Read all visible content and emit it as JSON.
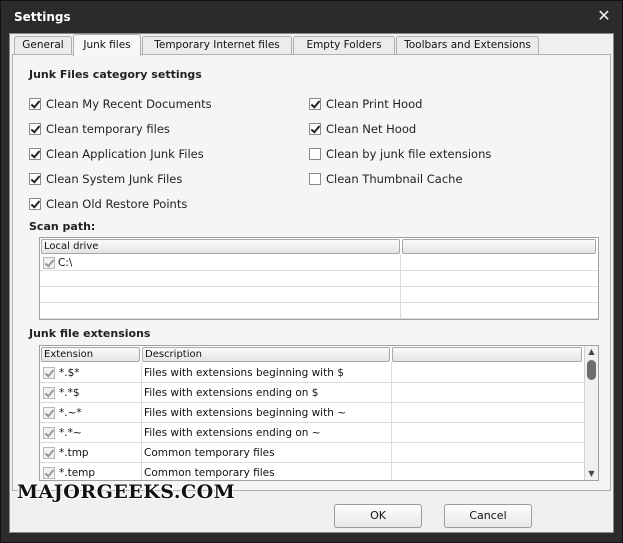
{
  "window": {
    "title": "Settings",
    "close_glyph": "✕"
  },
  "tabs": [
    {
      "label": "General",
      "active": false
    },
    {
      "label": "Junk files",
      "active": true
    },
    {
      "label": "Temporary Internet files",
      "active": false
    },
    {
      "label": "Empty Folders",
      "active": false
    },
    {
      "label": "Toolbars and Extensions",
      "active": false
    }
  ],
  "category": {
    "title": "Junk Files category settings",
    "left": [
      {
        "label": "Clean My Recent Documents",
        "checked": true
      },
      {
        "label": "Clean temporary files",
        "checked": true
      },
      {
        "label": "Clean Application Junk Files",
        "checked": true
      },
      {
        "label": "Clean System Junk Files",
        "checked": true
      },
      {
        "label": "Clean Old Restore Points",
        "checked": true
      }
    ],
    "right": [
      {
        "label": "Clean Print Hood",
        "checked": true
      },
      {
        "label": "Clean Net Hood",
        "checked": true
      },
      {
        "label": "Clean by junk file extensions",
        "checked": false
      },
      {
        "label": "Clean Thumbnail Cache",
        "checked": false
      }
    ]
  },
  "scan_path": {
    "title": "Scan path:",
    "columns": [
      "Local drive",
      ""
    ],
    "rows": [
      {
        "path": "C:\\",
        "checked": true
      }
    ]
  },
  "extensions": {
    "title": "Junk file extensions",
    "columns": [
      "Extension",
      "Description",
      ""
    ],
    "rows": [
      {
        "ext": "*.$*",
        "desc": "Files with extensions beginning with $",
        "checked": true
      },
      {
        "ext": "*.*$",
        "desc": "Files with extensions ending on $",
        "checked": true
      },
      {
        "ext": "*.~*",
        "desc": "Files with extensions beginning with ~",
        "checked": true
      },
      {
        "ext": "*.*~",
        "desc": "Files with extensions ending on ~",
        "checked": true
      },
      {
        "ext": "*.tmp",
        "desc": "Common temporary files",
        "checked": true
      },
      {
        "ext": "*.temp",
        "desc": "Common temporary files",
        "checked": true
      }
    ],
    "scroll_up_glyph": "▲",
    "scroll_down_glyph": "▼"
  },
  "buttons": {
    "ok": "OK",
    "cancel": "Cancel"
  },
  "watermark": "MAJORGEEKS.COM",
  "icons": {
    "close": "close-icon",
    "checkbox": "checkbox-check-icon",
    "scroll_up": "scroll-up-arrow-icon",
    "scroll_down": "scroll-down-arrow-icon"
  }
}
